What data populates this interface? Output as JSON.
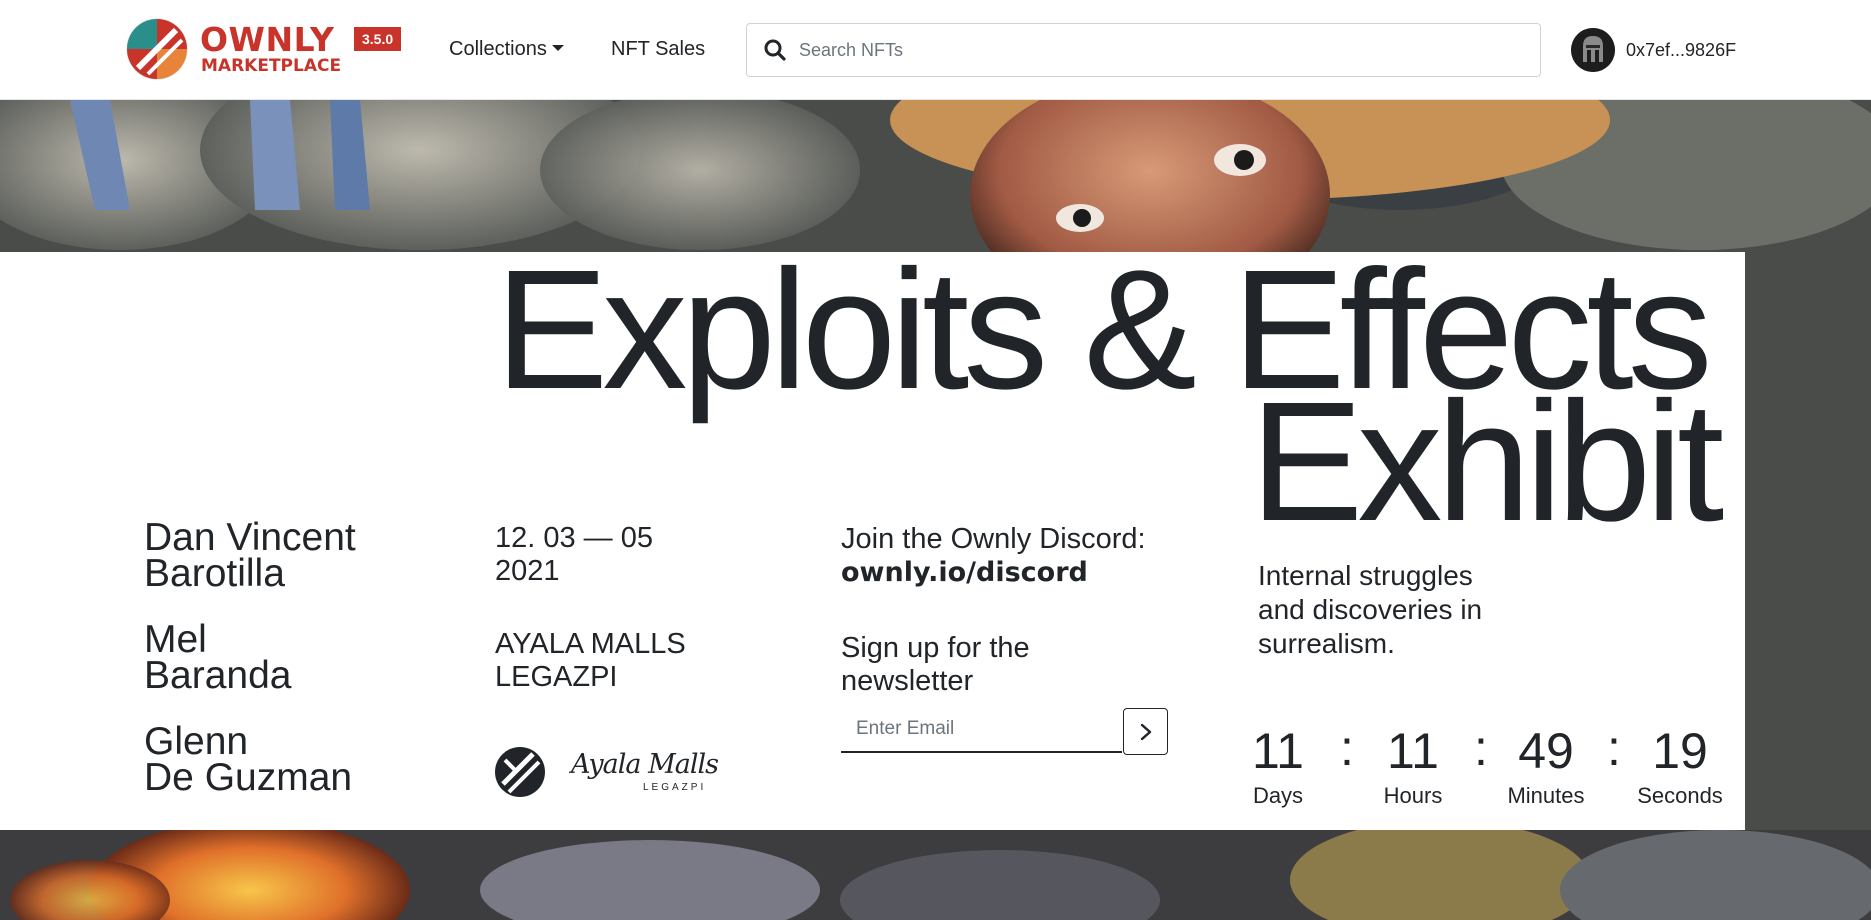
{
  "navbar": {
    "brand_name": "OWNLY",
    "brand_sub": "MARKETPLACE",
    "version": "3.5.0",
    "collections_label": "Collections",
    "nft_sales_label": "NFT Sales",
    "search_placeholder": "Search NFTs",
    "search_value": "",
    "wallet_address": "0x7ef...9826F"
  },
  "exhibit": {
    "title_line1": "Exploits & Effects",
    "title_line2": "Exhibit",
    "artists": [
      {
        "first": "Dan Vincent",
        "last": "Barotilla"
      },
      {
        "first": "Mel",
        "last": "Baranda"
      },
      {
        "first": "Glenn",
        "last": "De Guzman"
      }
    ],
    "dates": "12. 03 — 05 2021",
    "venue": "AYALA MALLS LEGAZPI",
    "partner_logo_text": "Ayala Malls",
    "partner_logo_sub": "LEGAZPI",
    "discord_label": "Join the Ownly Discord:",
    "discord_link": "ownly.io/discord",
    "newsletter_label": "Sign up for the newsletter",
    "email_placeholder": "Enter Email",
    "email_value": "",
    "tagline": "Internal struggles and discoveries in surrealism."
  },
  "countdown": {
    "days": "11",
    "days_label": "Days",
    "hours": "11",
    "hours_label": "Hours",
    "minutes": "49",
    "minutes_label": "Minutes",
    "seconds": "19",
    "seconds_label": "Seconds",
    "separator": ":"
  },
  "colors": {
    "brand_red": "#c8342a",
    "logo_teal": "#2a8f8a",
    "logo_orange": "#e8843a",
    "text_dark": "#212529"
  },
  "icons": {
    "search": "search-icon",
    "submit": "chevron-right-icon",
    "caret": "caret-down-icon"
  }
}
